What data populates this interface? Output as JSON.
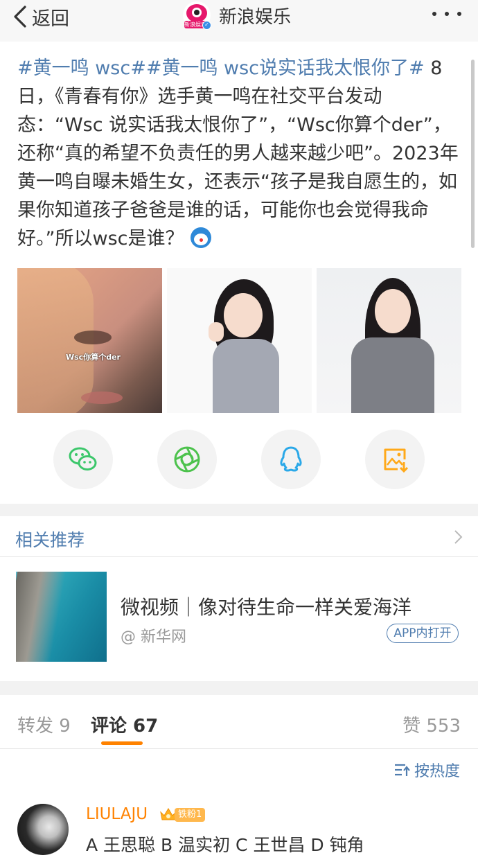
{
  "header": {
    "back_label": "返回",
    "account_name": "新浪娱乐",
    "avatar_tag": "新浪娱乐"
  },
  "post": {
    "hashtag": "#黄一鸣 wsc##黄一鸣 wsc说实话我太恨你了#",
    "body": " 8日，《青春有你》选手黄一鸣在社交平台发动态：“Wsc 说实话我太恨你了”，“Wsc你算个der”，还称“真的希望不负责任的男人越来越少吧”。2023年黄一鸣自曝未婚生女，还表示“孩子是我自愿生的，如果你知道孩子爸爸是谁的话，可能你也会觉得我命好。”所以wsc是谁？",
    "emoji": "doraemon-emoji",
    "photo_caption": "Wsc你算个der"
  },
  "share": [
    {
      "icon": "wechat-icon",
      "color": "#3cc76b"
    },
    {
      "icon": "moments-icon",
      "color": "#4cc24c"
    },
    {
      "icon": "qq-icon",
      "color": "#2aa8e8"
    },
    {
      "icon": "save-image-icon",
      "color": "#ffa91a"
    }
  ],
  "related": {
    "title": "相关推荐",
    "headline": "微视频｜像对待生命一样关爱海洋",
    "source": "@ 新华网",
    "app_button": "APP内打开"
  },
  "tabs": {
    "repost": "转发 9",
    "comments": "评论 67",
    "likes": "赞 553"
  },
  "sort": {
    "label": "按热度"
  },
  "comments": [
    {
      "user": "LIULAJU",
      "badge": "铁粉1",
      "text": "A 王思聪 B 温实初 C 王世昌 D 钝角"
    }
  ],
  "colors": {
    "link": "#507daf",
    "accent": "#ff8200"
  }
}
